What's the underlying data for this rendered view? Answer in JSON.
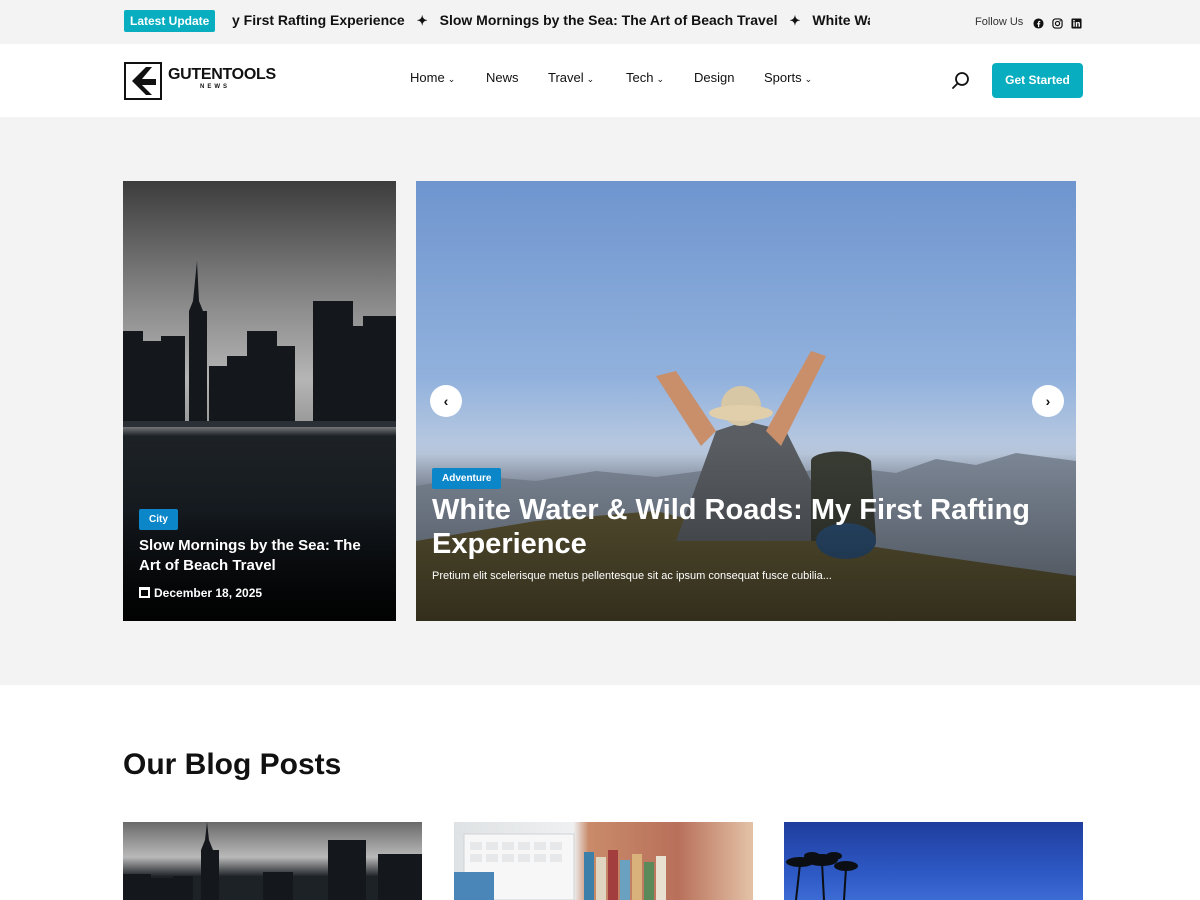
{
  "topbar": {
    "badge": "Latest Update",
    "ticker": [
      "y First Rafting Experience",
      "Slow Mornings by the Sea: The Art of Beach Travel",
      "White Water & W"
    ],
    "ticker_separator": "✦",
    "follow_label": "Follow Us",
    "social_icons": [
      "facebook-icon",
      "instagram-icon",
      "linkedin-icon"
    ]
  },
  "header": {
    "logo_name": "GUTENTOOLS",
    "logo_sub": "NEWS",
    "nav": [
      {
        "label": "Home",
        "has_dropdown": true
      },
      {
        "label": "News",
        "has_dropdown": false
      },
      {
        "label": "Travel",
        "has_dropdown": true
      },
      {
        "label": "Tech",
        "has_dropdown": true
      },
      {
        "label": "Design",
        "has_dropdown": false
      },
      {
        "label": "Sports",
        "has_dropdown": true
      }
    ],
    "cta": "Get Started"
  },
  "hero": {
    "left_card": {
      "category": "City",
      "title": "Slow Mornings by the Sea: The Art of Beach Travel",
      "date": "December 18, 2025"
    },
    "main_slide": {
      "category": "Adventure",
      "title": "White Water & Wild Roads: My First Rafting Experience",
      "excerpt": "Pretium elit scelerisque metus pellentesque sit ac ipsum consequat fusce cubilia..."
    },
    "prev_arrow": "‹",
    "next_arrow": "›"
  },
  "blog": {
    "heading": "Our Blog Posts"
  },
  "colors": {
    "accent": "#08aec0",
    "category_city": "#0b86c9",
    "category_adventure": "#0b86c9",
    "hero_background": "#f3f3f3"
  }
}
